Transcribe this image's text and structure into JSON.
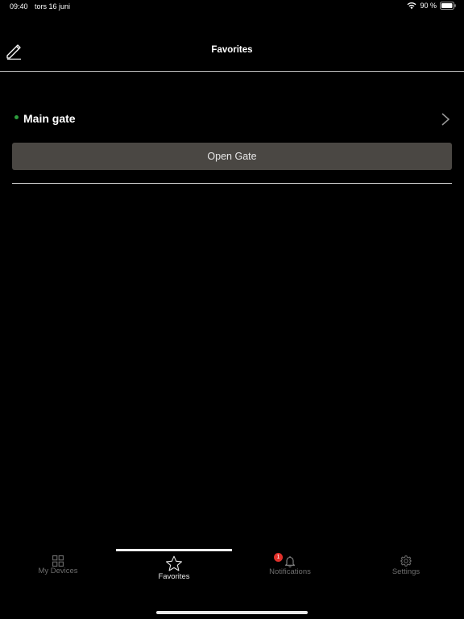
{
  "status_bar": {
    "time": "09:40",
    "date": "tors 16 juni",
    "battery": "90 %",
    "wifi_icon": "wifi-icon",
    "battery_icon": "battery-icon"
  },
  "header": {
    "title": "Favorites",
    "edit_icon": "edit-icon"
  },
  "device": {
    "name": "Main gate",
    "status_color": "#2e9e3e",
    "action_label": "Open Gate"
  },
  "tabs": [
    {
      "label": "My Devices",
      "icon": "grid-icon",
      "active": false
    },
    {
      "label": "Favorites",
      "icon": "star-icon",
      "active": true
    },
    {
      "label": "Notifications",
      "icon": "bell-icon",
      "active": false,
      "badge": "1"
    },
    {
      "label": "Settings",
      "icon": "gear-icon",
      "active": false
    }
  ],
  "colors": {
    "background": "#000000",
    "button": "#4a4743",
    "badge": "#e0302a"
  }
}
